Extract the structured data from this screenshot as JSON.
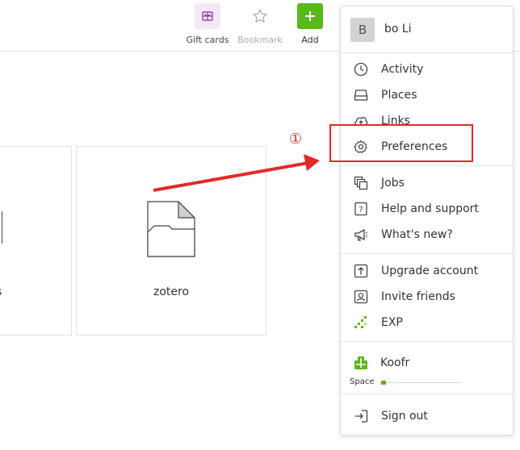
{
  "toolbar": {
    "gift_cards": "Gift cards",
    "bookmark": "Bookmark",
    "add": "Add"
  },
  "files": [
    {
      "name": "s"
    },
    {
      "name": "zotero"
    }
  ],
  "user": {
    "avatar_initial": "B",
    "name": "bo Li"
  },
  "menu": {
    "group1": [
      "Activity",
      "Places",
      "Links",
      "Preferences"
    ],
    "group2": [
      "Jobs",
      "Help and support",
      "What's new?"
    ],
    "group3": [
      "Upgrade account",
      "Invite friends",
      "EXP"
    ],
    "koofr": "Koofr",
    "space_label": "Space",
    "space_used_fraction": 0.06,
    "sign_out": "Sign out"
  },
  "annotation": {
    "step": "①"
  },
  "colors": {
    "accent_green": "#58b81b",
    "annotation_red": "#e32a2a",
    "gift_bg": "#f3e8f8",
    "gift_icon": "#8e44ad"
  }
}
